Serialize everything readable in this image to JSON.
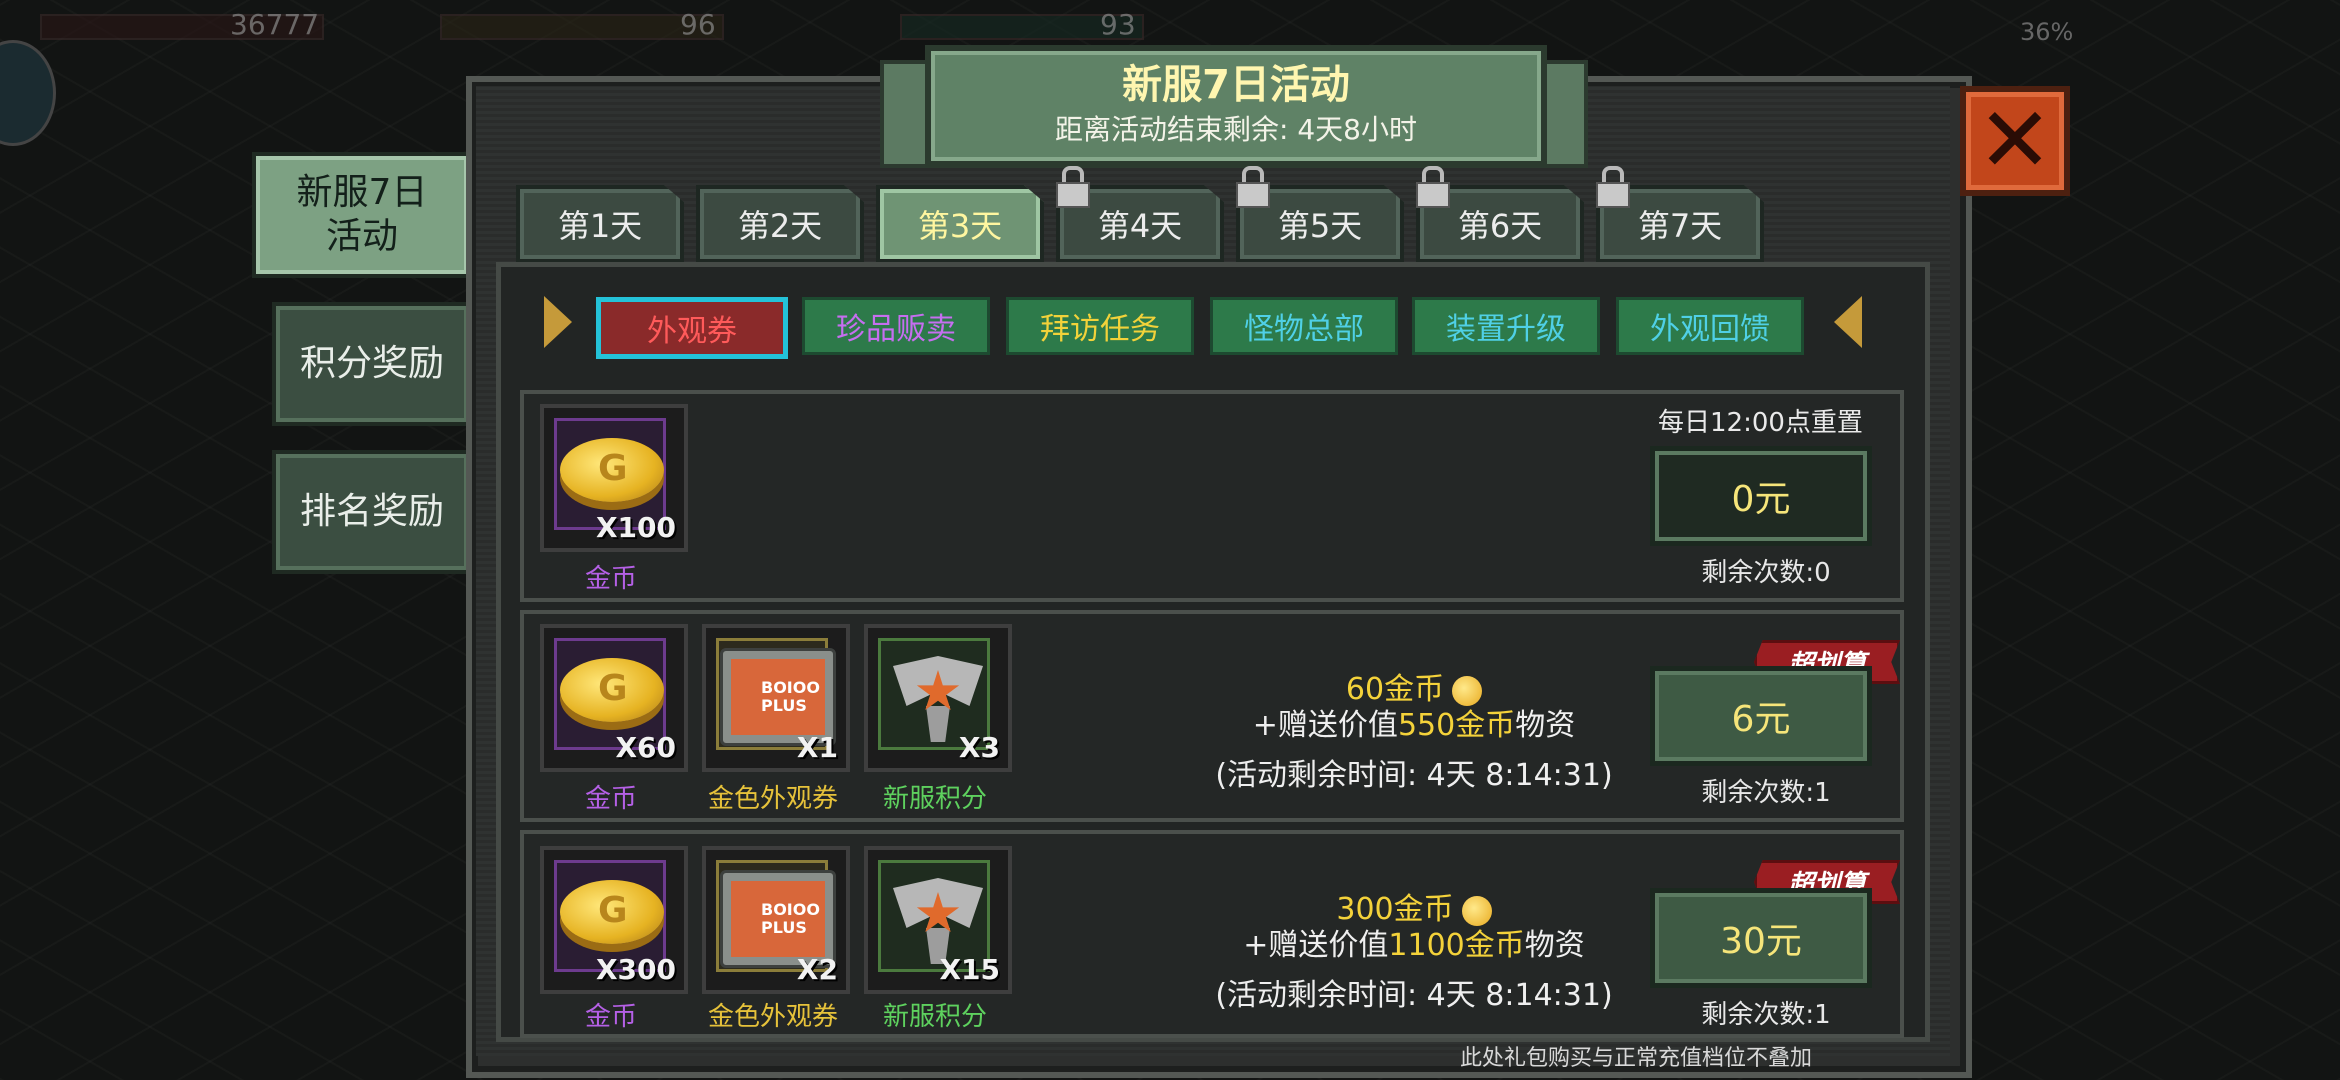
{
  "hud": {
    "val1": "36777",
    "val2": "96",
    "val3": "93",
    "val4": "36%"
  },
  "side_menu": [
    {
      "label": "新服7日\n活动"
    },
    {
      "label": "积分奖励"
    },
    {
      "label": "排名奖励"
    }
  ],
  "banner": {
    "title": "新服7日活动",
    "subtitle": "距离活动结束剩余: 4天8小时"
  },
  "close": {
    "icon": "close-icon",
    "glyph": "✕"
  },
  "days": [
    "第1天",
    "第2天",
    "第3天",
    "第4天",
    "第5天",
    "第6天",
    "第7天"
  ],
  "categories": [
    "外观券",
    "珍品贩卖",
    "拜访任务",
    "怪物总部",
    "装置升级",
    "外观回馈"
  ],
  "rows": [
    {
      "items": [
        {
          "name": "金币",
          "qty": "X100",
          "type": "coin",
          "tier": "purple"
        }
      ],
      "reset": "每日12:00点重置",
      "price": "0元",
      "remain": "剩余次数:0"
    },
    {
      "items": [
        {
          "name": "金币",
          "qty": "X60",
          "type": "coin",
          "tier": "purple"
        },
        {
          "name": "金色外观券",
          "qty": "X1",
          "type": "ticket",
          "tier": "gold"
        },
        {
          "name": "新服积分",
          "qty": "X3",
          "type": "badge",
          "tier": "green"
        }
      ],
      "deal": "超划算",
      "desc_gold": "60金币",
      "desc_line2_prefix": "+赠送价值",
      "desc_line2_value": "550金币",
      "desc_line2_suffix": "物资",
      "desc_time": "(活动剩余时间: 4天 8:14:31)",
      "price": "6元",
      "remain": "剩余次数:1"
    },
    {
      "items": [
        {
          "name": "金币",
          "qty": "X300",
          "type": "coin",
          "tier": "purple"
        },
        {
          "name": "金色外观券",
          "qty": "X2",
          "type": "ticket",
          "tier": "gold"
        },
        {
          "name": "新服积分",
          "qty": "X15",
          "type": "badge",
          "tier": "green"
        }
      ],
      "deal": "超划算",
      "desc_gold": "300金币",
      "desc_line2_prefix": "+赠送价值",
      "desc_line2_value": "1100金币",
      "desc_line2_suffix": "物资",
      "desc_time": "(活动剩余时间: 4天 8:14:31)",
      "price": "30元",
      "remain": "剩余次数:1"
    }
  ],
  "ticket_text": "BOIOO\nPLUS",
  "footnote": "此处礼包购买与正常充值档位不叠加"
}
